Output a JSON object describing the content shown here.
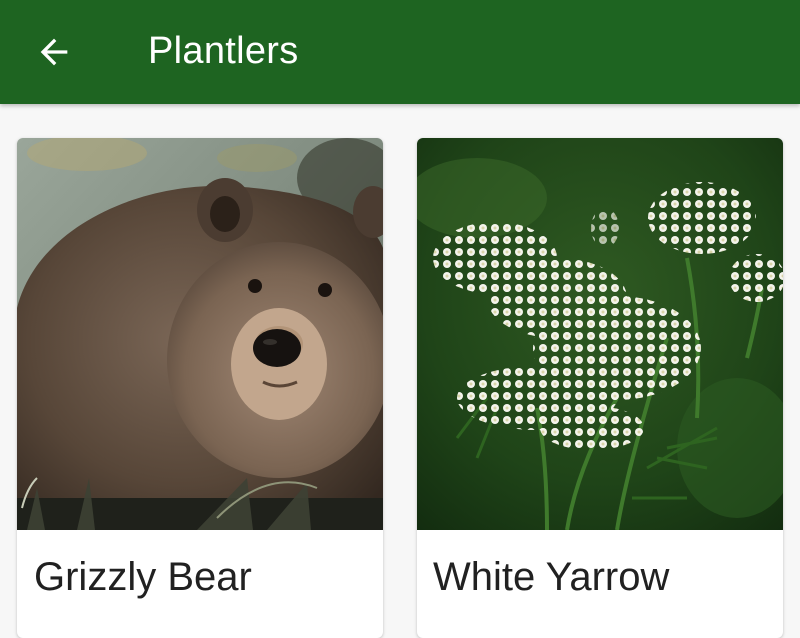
{
  "app_bar": {
    "title": "Plantlers",
    "back_icon": "arrow-back-icon",
    "background": "#1e6421"
  },
  "cards": [
    {
      "title": "Grizzly Bear",
      "image": "grizzly-bear-photo"
    },
    {
      "title": "White Yarrow",
      "image": "white-yarrow-photo"
    }
  ]
}
